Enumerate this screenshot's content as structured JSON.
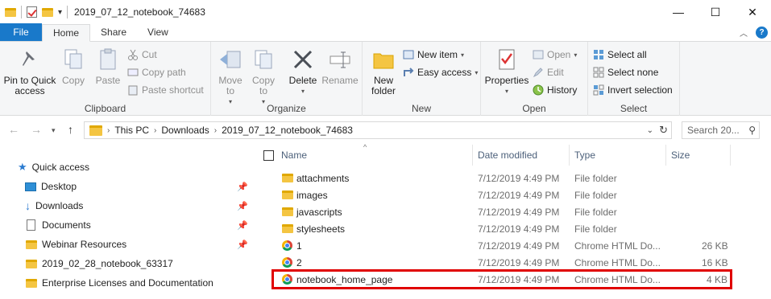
{
  "window": {
    "title": "2019_07_12_notebook_74683",
    "minimize": "—",
    "maximize": "☐",
    "close": "✕"
  },
  "tabs": [
    "File",
    "Home",
    "Share",
    "View"
  ],
  "help_label": "?",
  "ribbon": {
    "clipboard": {
      "label": "Clipboard",
      "pin": "Pin to Quick access",
      "copy": "Copy",
      "paste": "Paste",
      "cut": "Cut",
      "copy_path": "Copy path",
      "paste_shortcut": "Paste shortcut"
    },
    "organize": {
      "label": "Organize",
      "move_to": "Move to",
      "copy_to": "Copy to",
      "delete": "Delete",
      "rename": "Rename"
    },
    "new": {
      "label": "New",
      "new_folder": "New folder",
      "new_item": "New item",
      "easy_access": "Easy access"
    },
    "open": {
      "label": "Open",
      "properties": "Properties",
      "open": "Open",
      "edit": "Edit",
      "history": "History"
    },
    "select": {
      "label": "Select",
      "select_all": "Select all",
      "select_none": "Select none",
      "invert": "Invert selection"
    }
  },
  "address": {
    "crumbs": [
      "This PC",
      "Downloads",
      "2019_07_12_notebook_74683"
    ],
    "search_placeholder": "Search 20..."
  },
  "nav": {
    "quick_access": "Quick access",
    "items": [
      "Desktop",
      "Downloads",
      "Documents",
      "Webinar Resources",
      "2019_02_28_notebook_63317",
      "Enterprise Licenses and Documentation"
    ]
  },
  "columns": {
    "name": "Name",
    "date": "Date modified",
    "type": "Type",
    "size": "Size"
  },
  "files": [
    {
      "name": "attachments",
      "date": "7/12/2019 4:49 PM",
      "type": "File folder",
      "size": "",
      "kind": "folder"
    },
    {
      "name": "images",
      "date": "7/12/2019 4:49 PM",
      "type": "File folder",
      "size": "",
      "kind": "folder"
    },
    {
      "name": "javascripts",
      "date": "7/12/2019 4:49 PM",
      "type": "File folder",
      "size": "",
      "kind": "folder"
    },
    {
      "name": "stylesheets",
      "date": "7/12/2019 4:49 PM",
      "type": "File folder",
      "size": "",
      "kind": "folder"
    },
    {
      "name": "1",
      "date": "7/12/2019 4:49 PM",
      "type": "Chrome HTML Do...",
      "size": "26 KB",
      "kind": "chrome"
    },
    {
      "name": "2",
      "date": "7/12/2019 4:49 PM",
      "type": "Chrome HTML Do...",
      "size": "16 KB",
      "kind": "chrome"
    },
    {
      "name": "notebook_home_page",
      "date": "7/12/2019 4:49 PM",
      "type": "Chrome HTML Do...",
      "size": "4 KB",
      "kind": "chrome"
    }
  ],
  "colors": {
    "accent": "#1979ca",
    "highlight": "#e00000",
    "folder": "#f4c542"
  }
}
